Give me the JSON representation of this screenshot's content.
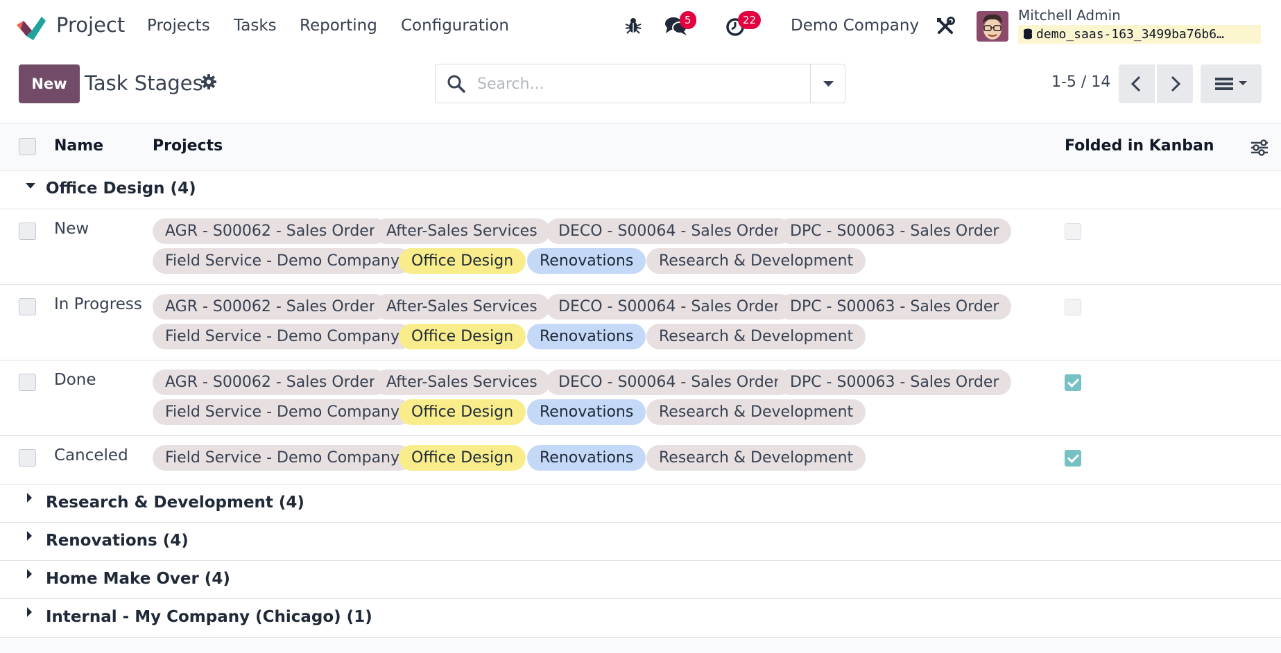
{
  "navbar": {
    "app_name": "Project",
    "menu": [
      "Projects",
      "Tasks",
      "Reporting",
      "Configuration"
    ],
    "messages_count": "5",
    "activities_count": "22",
    "company": "Demo Company",
    "user_name": "Mitchell Admin",
    "database": "demo_saas-163_3499ba76b6…"
  },
  "control_panel": {
    "new_label": "New",
    "title": "Task Stages",
    "search_placeholder": "Search...",
    "pager": "1-5 / 14"
  },
  "list": {
    "columns": {
      "name": "Name",
      "projects": "Projects",
      "folded": "Folded in Kanban"
    },
    "expanded_group": "Office Design (4)",
    "records": [
      {
        "name": "New",
        "folded": false,
        "tags": [
          "AGR - S00062 - Sales Order",
          "After-Sales Services",
          "DECO - S00064 - Sales Order",
          "DPC - S00063 - Sales Order",
          "Field Service - Demo Company",
          "Office Design",
          "Renovations",
          "Research & Development"
        ]
      },
      {
        "name": "In Progress",
        "folded": false,
        "tags": [
          "AGR - S00062 - Sales Order",
          "After-Sales Services",
          "DECO - S00064 - Sales Order",
          "DPC - S00063 - Sales Order",
          "Field Service - Demo Company",
          "Office Design",
          "Renovations",
          "Research & Development"
        ]
      },
      {
        "name": "Done",
        "folded": true,
        "tags": [
          "AGR - S00062 - Sales Order",
          "After-Sales Services",
          "DECO - S00064 - Sales Order",
          "DPC - S00063 - Sales Order",
          "Field Service - Demo Company",
          "Office Design",
          "Renovations",
          "Research & Development"
        ]
      },
      {
        "name": "Canceled",
        "folded": true,
        "tags": [
          "Field Service - Demo Company",
          "Office Design",
          "Renovations",
          "Research & Development"
        ]
      }
    ],
    "collapsed_groups": [
      "Research & Development (4)",
      "Renovations (4)",
      "Home Make Over (4)",
      "Internal - My Company (Chicago) (1)"
    ]
  },
  "colors": {
    "brand": "#714b67",
    "badge": "#e30040",
    "checked": "#77c1c5",
    "tag_default": "#e8dfe1",
    "tag_office_design": "#f8ed8a",
    "tag_renovations": "#c4d8f7"
  }
}
